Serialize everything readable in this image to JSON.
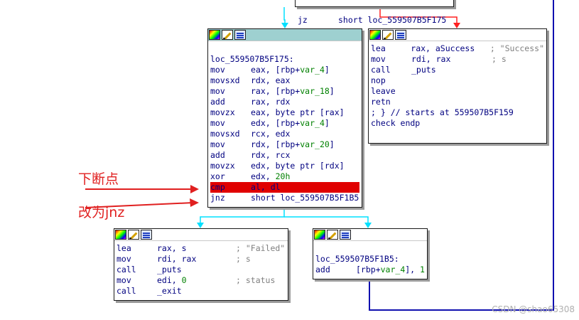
{
  "top_fragment": {
    "mnemonic": "jz",
    "operand": "short loc_559507B5F175"
  },
  "blocks": {
    "main": {
      "lines": [
        {
          "label": "loc_559507B5F175:"
        },
        {
          "m": "mov",
          "ops": "eax, [rbp+var_4]"
        },
        {
          "m": "movsxd",
          "ops": "rdx, eax"
        },
        {
          "m": "mov",
          "ops": "rax, [rbp+var_18]"
        },
        {
          "m": "add",
          "ops": "rax, rdx"
        },
        {
          "m": "movzx",
          "ops": "eax, byte ptr [rax]"
        },
        {
          "m": "mov",
          "ops": "edx, [rbp+var_4]"
        },
        {
          "m": "movsxd",
          "ops": "rcx, edx"
        },
        {
          "m": "mov",
          "ops": "rdx, [rbp+var_20]"
        },
        {
          "m": "add",
          "ops": "rdx, rcx"
        },
        {
          "m": "movzx",
          "ops": "edx, byte ptr [rdx]"
        },
        {
          "m": "xor",
          "ops": "edx, 20h"
        },
        {
          "m": "cmp",
          "ops": "al, dl",
          "highlight": true
        },
        {
          "m": "jnz",
          "ops": "short loc_559507B5F1B5"
        }
      ]
    },
    "success": {
      "lines": [
        {
          "m": "lea",
          "ops": "rax, aSuccess",
          "comment": "; \"Success\""
        },
        {
          "m": "mov",
          "ops": "rdi, rax",
          "comment": "; s"
        },
        {
          "m": "call",
          "ops": "_puts"
        },
        {
          "m": "nop",
          "ops": ""
        },
        {
          "m": "leave",
          "ops": ""
        },
        {
          "m": "retn",
          "ops": ""
        },
        {
          "raw": "; } // starts at 559507B5F159"
        },
        {
          "raw": "check endp"
        }
      ]
    },
    "failed": {
      "lines": [
        {
          "m": "lea",
          "ops": "rax, s",
          "comment": "; \"Failed\""
        },
        {
          "m": "mov",
          "ops": "rdi, rax",
          "comment": "; s"
        },
        {
          "m": "call",
          "ops": "_puts"
        },
        {
          "m": "mov",
          "ops": "edi, 0",
          "comment": "; status"
        },
        {
          "m": "call",
          "ops": "_exit"
        }
      ]
    },
    "loop": {
      "lines": [
        {
          "label": "loc_559507B5F1B5:"
        },
        {
          "m": "add",
          "ops": "[rbp+var_4], 1"
        }
      ]
    }
  },
  "annotations": {
    "breakpoint": "下断点",
    "patch": "改为jnz"
  },
  "watermark": "CSDN @shao65308",
  "colors": {
    "true_edge": "#00e0ff",
    "false_edge": "#ff2020",
    "back_edge": "#1010b0",
    "highlight": "#e00000",
    "selected_header": "#9ed0d0"
  }
}
